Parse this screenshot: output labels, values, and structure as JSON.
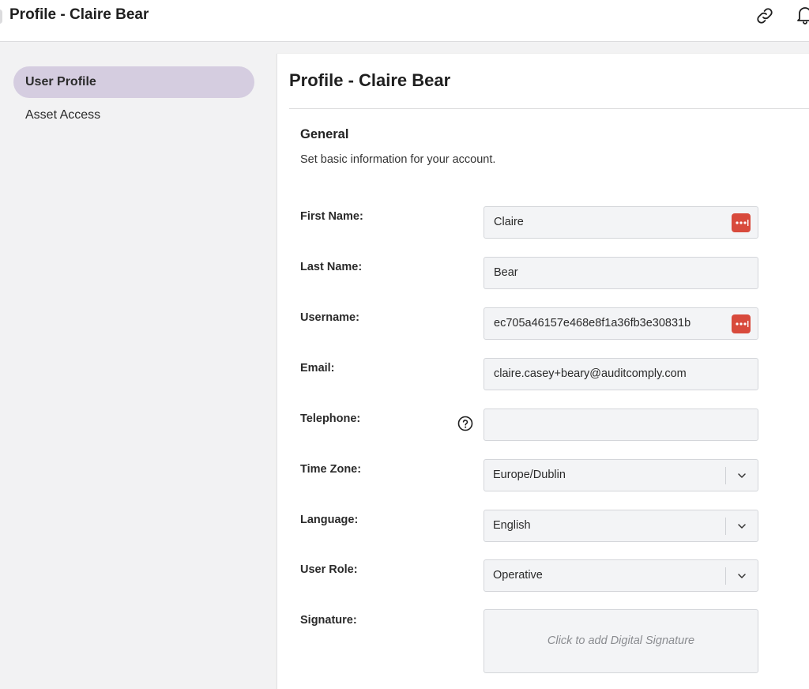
{
  "header": {
    "title": "Profile - Claire Bear",
    "icons": [
      "link-icon",
      "bell-icon"
    ]
  },
  "sidebar": {
    "items": [
      {
        "label": "User Profile",
        "active": true
      },
      {
        "label": "Asset Access",
        "active": false
      }
    ]
  },
  "panel": {
    "title": "Profile - Claire Bear",
    "section": {
      "title": "General",
      "description": "Set basic information for your account."
    },
    "fields": {
      "first_name": {
        "label": "First Name:",
        "value": "Claire"
      },
      "last_name": {
        "label": "Last Name:",
        "value": "Bear"
      },
      "username": {
        "label": "Username:",
        "value": "ec705a46157e468e8f1a36fb3e30831b"
      },
      "email": {
        "label": "Email:",
        "value": "claire.casey+beary@auditcomply.com"
      },
      "telephone": {
        "label": "Telephone:",
        "value": ""
      },
      "time_zone": {
        "label": "Time Zone:",
        "value": "Europe/Dublin"
      },
      "language": {
        "label": "Language:",
        "value": "English"
      },
      "user_role": {
        "label": "User Role:",
        "value": "Operative"
      },
      "signature": {
        "label": "Signature:",
        "placeholder": "Click to add Digital Signature"
      }
    }
  },
  "colors": {
    "active_nav_bg": "#d5cde0",
    "password_manager_badge": "#d84a3c",
    "field_bg": "#f3f4f6"
  }
}
